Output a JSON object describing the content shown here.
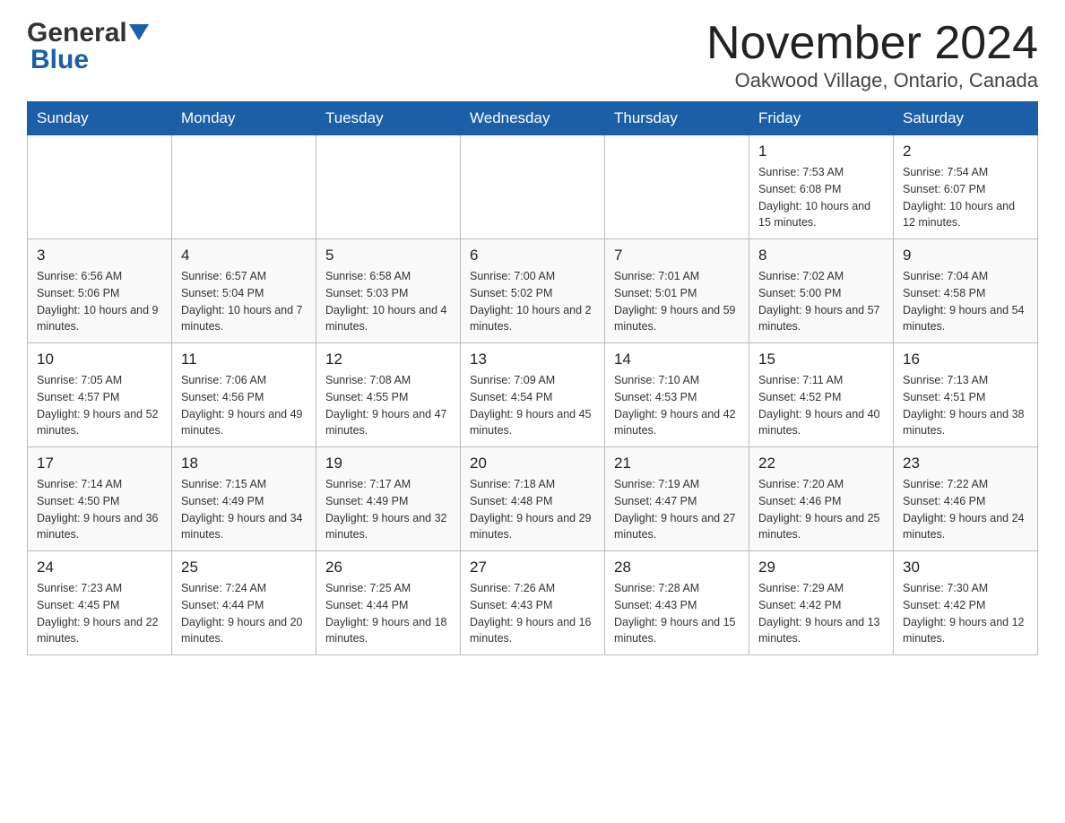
{
  "header": {
    "logo_general": "General",
    "logo_blue": "Blue",
    "month_title": "November 2024",
    "location": "Oakwood Village, Ontario, Canada"
  },
  "days_of_week": [
    "Sunday",
    "Monday",
    "Tuesday",
    "Wednesday",
    "Thursday",
    "Friday",
    "Saturday"
  ],
  "weeks": [
    {
      "days": [
        {
          "number": "",
          "info": ""
        },
        {
          "number": "",
          "info": ""
        },
        {
          "number": "",
          "info": ""
        },
        {
          "number": "",
          "info": ""
        },
        {
          "number": "",
          "info": ""
        },
        {
          "number": "1",
          "info": "Sunrise: 7:53 AM\nSunset: 6:08 PM\nDaylight: 10 hours and 15 minutes."
        },
        {
          "number": "2",
          "info": "Sunrise: 7:54 AM\nSunset: 6:07 PM\nDaylight: 10 hours and 12 minutes."
        }
      ]
    },
    {
      "days": [
        {
          "number": "3",
          "info": "Sunrise: 6:56 AM\nSunset: 5:06 PM\nDaylight: 10 hours and 9 minutes."
        },
        {
          "number": "4",
          "info": "Sunrise: 6:57 AM\nSunset: 5:04 PM\nDaylight: 10 hours and 7 minutes."
        },
        {
          "number": "5",
          "info": "Sunrise: 6:58 AM\nSunset: 5:03 PM\nDaylight: 10 hours and 4 minutes."
        },
        {
          "number": "6",
          "info": "Sunrise: 7:00 AM\nSunset: 5:02 PM\nDaylight: 10 hours and 2 minutes."
        },
        {
          "number": "7",
          "info": "Sunrise: 7:01 AM\nSunset: 5:01 PM\nDaylight: 9 hours and 59 minutes."
        },
        {
          "number": "8",
          "info": "Sunrise: 7:02 AM\nSunset: 5:00 PM\nDaylight: 9 hours and 57 minutes."
        },
        {
          "number": "9",
          "info": "Sunrise: 7:04 AM\nSunset: 4:58 PM\nDaylight: 9 hours and 54 minutes."
        }
      ]
    },
    {
      "days": [
        {
          "number": "10",
          "info": "Sunrise: 7:05 AM\nSunset: 4:57 PM\nDaylight: 9 hours and 52 minutes."
        },
        {
          "number": "11",
          "info": "Sunrise: 7:06 AM\nSunset: 4:56 PM\nDaylight: 9 hours and 49 minutes."
        },
        {
          "number": "12",
          "info": "Sunrise: 7:08 AM\nSunset: 4:55 PM\nDaylight: 9 hours and 47 minutes."
        },
        {
          "number": "13",
          "info": "Sunrise: 7:09 AM\nSunset: 4:54 PM\nDaylight: 9 hours and 45 minutes."
        },
        {
          "number": "14",
          "info": "Sunrise: 7:10 AM\nSunset: 4:53 PM\nDaylight: 9 hours and 42 minutes."
        },
        {
          "number": "15",
          "info": "Sunrise: 7:11 AM\nSunset: 4:52 PM\nDaylight: 9 hours and 40 minutes."
        },
        {
          "number": "16",
          "info": "Sunrise: 7:13 AM\nSunset: 4:51 PM\nDaylight: 9 hours and 38 minutes."
        }
      ]
    },
    {
      "days": [
        {
          "number": "17",
          "info": "Sunrise: 7:14 AM\nSunset: 4:50 PM\nDaylight: 9 hours and 36 minutes."
        },
        {
          "number": "18",
          "info": "Sunrise: 7:15 AM\nSunset: 4:49 PM\nDaylight: 9 hours and 34 minutes."
        },
        {
          "number": "19",
          "info": "Sunrise: 7:17 AM\nSunset: 4:49 PM\nDaylight: 9 hours and 32 minutes."
        },
        {
          "number": "20",
          "info": "Sunrise: 7:18 AM\nSunset: 4:48 PM\nDaylight: 9 hours and 29 minutes."
        },
        {
          "number": "21",
          "info": "Sunrise: 7:19 AM\nSunset: 4:47 PM\nDaylight: 9 hours and 27 minutes."
        },
        {
          "number": "22",
          "info": "Sunrise: 7:20 AM\nSunset: 4:46 PM\nDaylight: 9 hours and 25 minutes."
        },
        {
          "number": "23",
          "info": "Sunrise: 7:22 AM\nSunset: 4:46 PM\nDaylight: 9 hours and 24 minutes."
        }
      ]
    },
    {
      "days": [
        {
          "number": "24",
          "info": "Sunrise: 7:23 AM\nSunset: 4:45 PM\nDaylight: 9 hours and 22 minutes."
        },
        {
          "number": "25",
          "info": "Sunrise: 7:24 AM\nSunset: 4:44 PM\nDaylight: 9 hours and 20 minutes."
        },
        {
          "number": "26",
          "info": "Sunrise: 7:25 AM\nSunset: 4:44 PM\nDaylight: 9 hours and 18 minutes."
        },
        {
          "number": "27",
          "info": "Sunrise: 7:26 AM\nSunset: 4:43 PM\nDaylight: 9 hours and 16 minutes."
        },
        {
          "number": "28",
          "info": "Sunrise: 7:28 AM\nSunset: 4:43 PM\nDaylight: 9 hours and 15 minutes."
        },
        {
          "number": "29",
          "info": "Sunrise: 7:29 AM\nSunset: 4:42 PM\nDaylight: 9 hours and 13 minutes."
        },
        {
          "number": "30",
          "info": "Sunrise: 7:30 AM\nSunset: 4:42 PM\nDaylight: 9 hours and 12 minutes."
        }
      ]
    }
  ]
}
